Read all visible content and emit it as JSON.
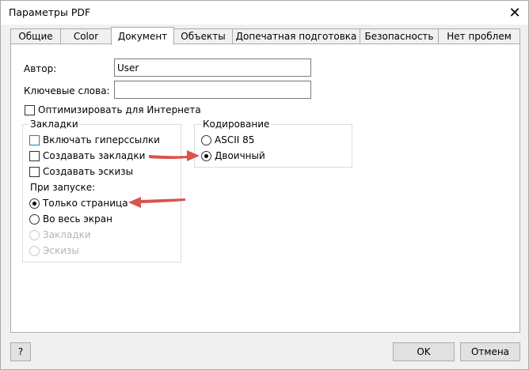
{
  "window": {
    "title": "Параметры PDF"
  },
  "tabs": [
    {
      "label": "Общие"
    },
    {
      "label": "Color"
    },
    {
      "label": "Документ",
      "active": true
    },
    {
      "label": "Объекты"
    },
    {
      "label": "Допечатная подготовка"
    },
    {
      "label": "Безопасность"
    },
    {
      "label": "Нет проблем"
    }
  ],
  "document": {
    "author_label": "Автор:",
    "author_value": "User",
    "keywords_label": "Ключевые слова:",
    "keywords_value": "",
    "optimize_label": "Оптимизировать для Интернета",
    "optimize_checked": false
  },
  "bookmarks": {
    "group_title": "Закладки",
    "include_hyperlinks": {
      "label": "Включать гиперссылки",
      "checked": false
    },
    "create_bookmarks": {
      "label": "Создавать закладки",
      "checked": false
    },
    "create_thumbnails": {
      "label": "Создавать эскизы",
      "checked": false
    },
    "on_start_label": "При запуске:",
    "on_start_options": [
      {
        "label": "Только страница",
        "checked": true,
        "enabled": true
      },
      {
        "label": "Во весь экран",
        "checked": false,
        "enabled": true
      },
      {
        "label": "Закладки",
        "checked": false,
        "enabled": false
      },
      {
        "label": "Эскизы",
        "checked": false,
        "enabled": false
      }
    ]
  },
  "encoding": {
    "group_title": "Кодирование",
    "options": [
      {
        "label": "ASCII 85",
        "checked": false
      },
      {
        "label": "Двоичный",
        "checked": true
      }
    ]
  },
  "footer": {
    "help_label": "?",
    "ok_label": "OK",
    "cancel_label": "Отмена"
  },
  "colors": {
    "annotation_arrow": "#d9534f",
    "focus_border": "#1e7fb8"
  }
}
